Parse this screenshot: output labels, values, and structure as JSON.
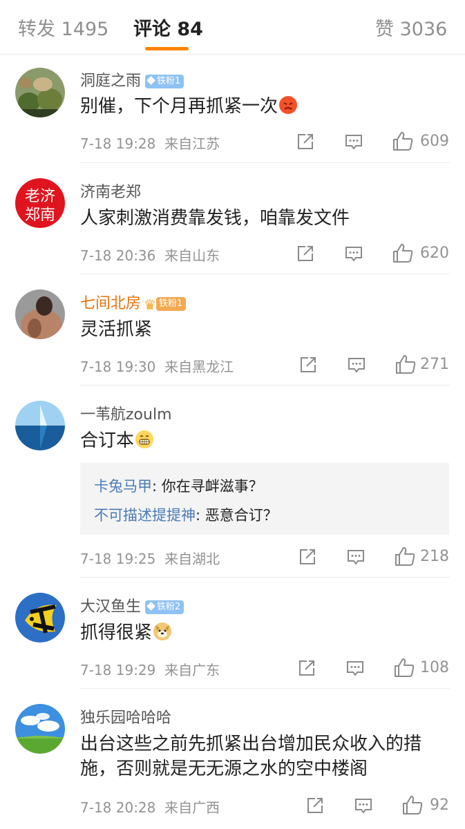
{
  "tabs": [
    {
      "label": "转发 1495"
    },
    {
      "label": "评论 84"
    },
    {
      "label": "赞 3036"
    }
  ],
  "colors": {
    "accent": "#ff8200",
    "reply_name": "#4a7ab5",
    "vip_name": "#e8700a",
    "meta": "#939393"
  },
  "comments": [
    {
      "username": "洞庭之雨",
      "badge": "铁粉1",
      "text": "别催，下个月再抓紧一次",
      "emoji": "angry-face",
      "date": "7-18 19:28",
      "location": "来自江苏",
      "likes": "609"
    },
    {
      "username": "济南老郑",
      "avatar_text": "老济郑南",
      "text": "人家刺激消费靠发钱，咱靠发文件",
      "date": "7-18 20:36",
      "location": "来自山东",
      "likes": "620"
    },
    {
      "username": "七间北房",
      "badge": "铁粉1",
      "text": "灵活抓紧",
      "date": "7-18 19:30",
      "location": "来自黑龙江",
      "likes": "271"
    },
    {
      "username": "一苇航zoulm",
      "text": "合订本",
      "emoji": "grin-face",
      "replies": [
        {
          "name": "卡兔马甲",
          "text": ": 你在寻衅滋事？"
        },
        {
          "name": "不可描述提提神",
          "text": ": 恶意合订？"
        }
      ],
      "date": "7-18 19:25",
      "location": "来自湖北",
      "likes": "218"
    },
    {
      "username": "大汉鱼生",
      "badge": "铁粉2",
      "text": "抓得很紧",
      "emoji": "doge-face",
      "date": "7-18 19:29",
      "location": "来自广东",
      "likes": "108"
    },
    {
      "username": "独乐园哈哈哈",
      "text": "出台这些之前先抓紧出台增加民众收入的措施，否则就是无无源之水的空中楼阁",
      "date": "7-18 20:28",
      "location": "来自广西",
      "likes": "92"
    }
  ]
}
